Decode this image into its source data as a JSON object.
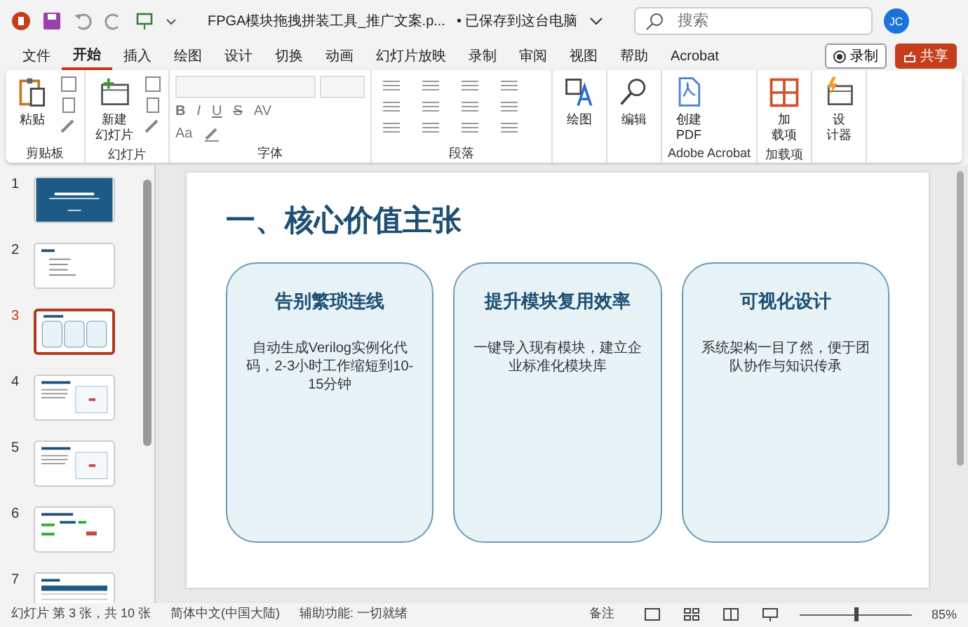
{
  "title_bar": {
    "file_name": "FPGA模块拖拽拼装工具_推广文案.p...",
    "save_status": "• 已保存到这台电脑",
    "search": {
      "placeholder": "搜索"
    },
    "avatar": "JC"
  },
  "menu_tabs": [
    {
      "label": "文件",
      "selected": false
    },
    {
      "label": "开始",
      "selected": true
    },
    {
      "label": "插入",
      "selected": false
    },
    {
      "label": "绘图",
      "selected": false
    },
    {
      "label": "设计",
      "selected": false
    },
    {
      "label": "切换",
      "selected": false
    },
    {
      "label": "动画",
      "selected": false
    },
    {
      "label": "幻灯片放映",
      "selected": false
    },
    {
      "label": "录制",
      "selected": false
    },
    {
      "label": "审阅",
      "selected": false
    },
    {
      "label": "视图",
      "selected": false
    },
    {
      "label": "帮助",
      "selected": false
    },
    {
      "label": "Acrobat",
      "selected": false
    }
  ],
  "record_button": "录制",
  "share_button": "共享",
  "ribbon_groups": [
    {
      "kind": "clipboard",
      "label": "剪贴板",
      "buttons": [
        {
          "lines": [
            "粘贴"
          ],
          "kind": "paste"
        }
      ]
    },
    {
      "kind": "slides",
      "label": "幻灯片",
      "buttons": [
        {
          "lines": [
            "新建",
            "幻灯片"
          ],
          "kind": "new-slide"
        }
      ]
    },
    {
      "kind": "font",
      "label": "字体",
      "format_buttons": [
        "B",
        "I",
        "U",
        "S",
        "AV",
        "Aa"
      ]
    },
    {
      "kind": "paragraph",
      "label": "段落"
    },
    {
      "kind": "large",
      "buttons": [
        {
          "lines": [
            "绘图"
          ],
          "kind": "draw"
        }
      ]
    },
    {
      "kind": "large",
      "buttons": [
        {
          "lines": [
            "编辑"
          ],
          "kind": "edit"
        }
      ]
    },
    {
      "kind": "large",
      "label": "Adobe Acrobat",
      "buttons": [
        {
          "lines": [
            "创建",
            "PDF"
          ],
          "kind": "pdf"
        }
      ]
    },
    {
      "kind": "large",
      "label": "加载项",
      "buttons": [
        {
          "lines": [
            "加",
            "载项"
          ],
          "kind": "addins"
        }
      ]
    },
    {
      "kind": "large",
      "buttons": [
        {
          "lines": [
            "设",
            "计器"
          ],
          "kind": "designer"
        }
      ]
    }
  ],
  "thumbnails": [
    {
      "number": "1",
      "kind": "title",
      "selected": false
    },
    {
      "number": "2",
      "kind": "list",
      "selected": false
    },
    {
      "number": "3",
      "kind": "cards",
      "selected": true
    },
    {
      "number": "4",
      "kind": "split",
      "selected": false
    },
    {
      "number": "5",
      "kind": "split",
      "selected": false
    },
    {
      "number": "6",
      "kind": "diagram",
      "selected": false
    },
    {
      "number": "7",
      "kind": "table",
      "selected": false
    }
  ],
  "slide": {
    "title": "一、核心价值主张",
    "cards": [
      {
        "heading": "告别繁琐连线",
        "body": "自动生成Verilog实例化代码，2-3小时工作缩短到10-15分钟"
      },
      {
        "heading": "提升模块复用效率",
        "body": "一键导入现有模块，建立企业标准化模块库"
      },
      {
        "heading": "可视化设计",
        "body": "系统架构一目了然，便于团队协作与知识传承"
      }
    ]
  },
  "status_bar": {
    "slide_position": "幻灯片 第 3 张，共 10 张",
    "language": "简体中文(中国大陆)",
    "accessibility": "辅助功能: 一切就绪",
    "notes": "备注",
    "zoom": {
      "level": 0.5,
      "reading": "85%"
    }
  }
}
